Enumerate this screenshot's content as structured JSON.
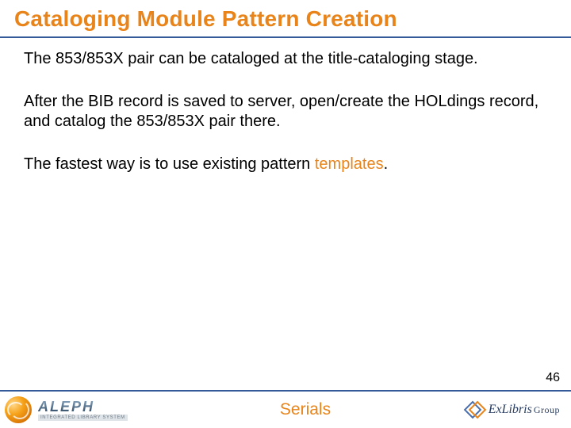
{
  "title": "Cataloging Module Pattern Creation",
  "paragraphs": {
    "p1": "The 853/853X pair can be cataloged at the title-cataloging stage.",
    "p2": "After the BIB record is saved to server, open/create the HOLdings record, and catalog the 853/853X pair there.",
    "p3_a": "The fastest way is to use existing pattern ",
    "p3_b": "templates",
    "p3_c": "."
  },
  "page_number": "46",
  "footer": {
    "center": "Serials",
    "aleph_word": "ALEPH",
    "aleph_sub": "INTEGRATED LIBRARY SYSTEM",
    "exlibris_a": "ExLibris",
    "exlibris_b": "Group"
  }
}
